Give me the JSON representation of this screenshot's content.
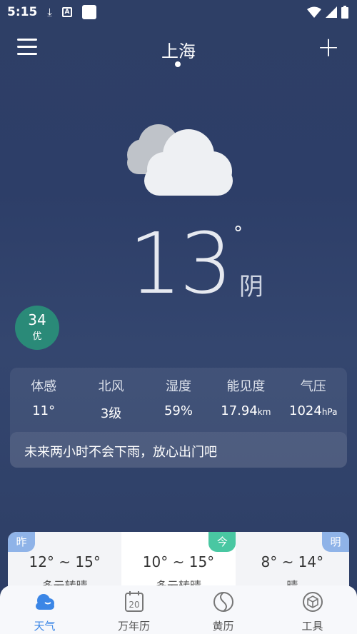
{
  "status": {
    "time": "5:15"
  },
  "header": {
    "city": "上海"
  },
  "current": {
    "temperature": "13",
    "degree": "°",
    "condition": "阴"
  },
  "aqi": {
    "value": "34",
    "level": "优"
  },
  "stats": [
    {
      "label": "体感",
      "value": "11°",
      "unit": ""
    },
    {
      "label": "北风",
      "value": "3级",
      "unit": ""
    },
    {
      "label": "湿度",
      "value": "59%",
      "unit": ""
    },
    {
      "label": "能见度",
      "value": "17.94",
      "unit": "km"
    },
    {
      "label": "气压",
      "value": "1024",
      "unit": "hPa"
    }
  ],
  "tip": "未来两小时不会下雨，放心出门吧",
  "forecast": [
    {
      "tag": "昨",
      "range": "12° ~ 15°",
      "desc": "多云转晴"
    },
    {
      "tag": "今",
      "range": "10° ~ 15°",
      "desc": "多云转晴"
    },
    {
      "tag": "明",
      "range": "8° ~ 14°",
      "desc": "晴"
    }
  ],
  "nav": [
    {
      "label": "天气",
      "icon": "cloud-icon"
    },
    {
      "label": "万年历",
      "icon": "calendar-icon",
      "badge": "20"
    },
    {
      "label": "黄历",
      "icon": "yin-yang-icon"
    },
    {
      "label": "工具",
      "icon": "cube-icon"
    }
  ],
  "colors": {
    "accent": "#3b86e6",
    "aqi": "#2a8a78",
    "today_tag": "#49c7a2"
  }
}
